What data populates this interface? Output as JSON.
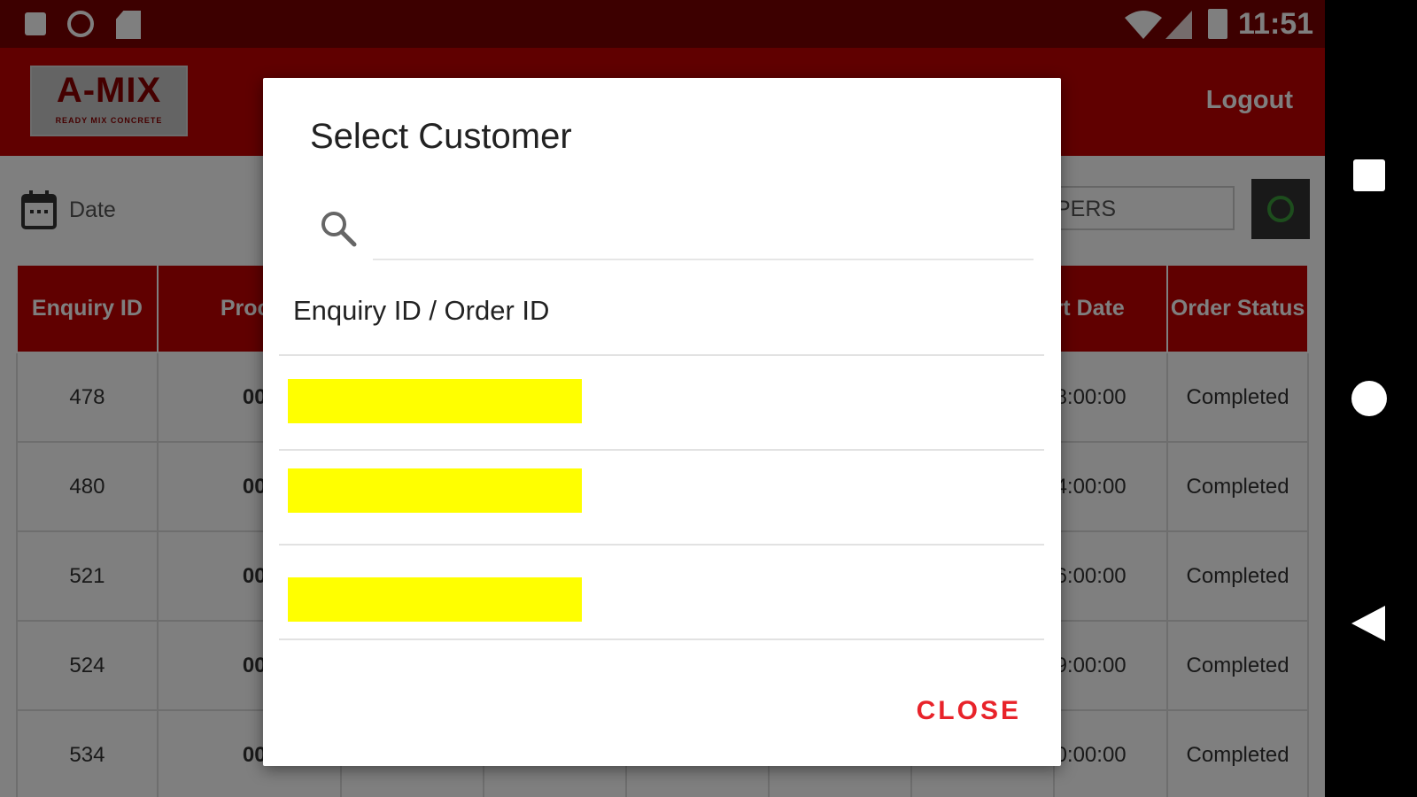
{
  "status_bar": {
    "time": "11:51",
    "notification_icons": [
      "a-icon",
      "record-icon",
      "sdcard-icon"
    ],
    "system_icons": [
      "wifi-icon",
      "signal-icon",
      "battery-icon"
    ]
  },
  "app_bar": {
    "logo_text": "A-MIX",
    "logo_subtext": "READY MIX CONCRETE",
    "logout_label": "Logout"
  },
  "filters": {
    "date_label": "Date",
    "search_visible_text": "PERS"
  },
  "table": {
    "headers": [
      "Enquiry ID",
      "Proc",
      "",
      "",
      "",
      "",
      "",
      "rt Date",
      "Order Status"
    ],
    "rows": [
      {
        "id": "478",
        "proc": "00",
        "date": "8:00:00",
        "status": "Completed"
      },
      {
        "id": "480",
        "proc": "00",
        "date": "4:00:00",
        "status": "Completed"
      },
      {
        "id": "521",
        "proc": "00",
        "date": "6:00:00",
        "status": "Completed"
      },
      {
        "id": "524",
        "proc": "00",
        "date": "9:00:00",
        "status": "Completed"
      },
      {
        "id": "534",
        "proc": "00",
        "date": "0:00:00",
        "status": "Completed"
      }
    ]
  },
  "dialog": {
    "title": "Select Customer",
    "search_placeholder": "",
    "list_header": "Enquiry ID / Order ID",
    "items": [
      "",
      "",
      ""
    ],
    "close_label": "CLOSE"
  },
  "colors": {
    "brand_red": "#c00000",
    "status_bar": "#7a0000",
    "highlight_yellow": "#ffff00",
    "close_red": "#e8232a"
  }
}
